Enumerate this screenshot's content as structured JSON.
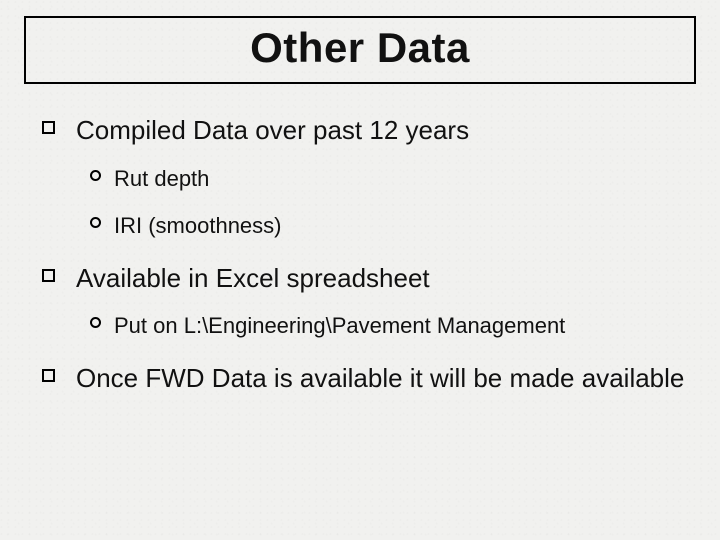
{
  "title": "Other Data",
  "bullets": [
    {
      "text": "Compiled Data over past 12 years",
      "children": [
        {
          "text": "Rut depth"
        },
        {
          "text": "IRI (smoothness)"
        }
      ]
    },
    {
      "text": "Available in Excel spreadsheet",
      "children": [
        {
          "text": "Put on L:\\Engineering\\Pavement Management"
        }
      ]
    },
    {
      "text": "Once FWD Data is available it will be made available",
      "children": []
    }
  ]
}
